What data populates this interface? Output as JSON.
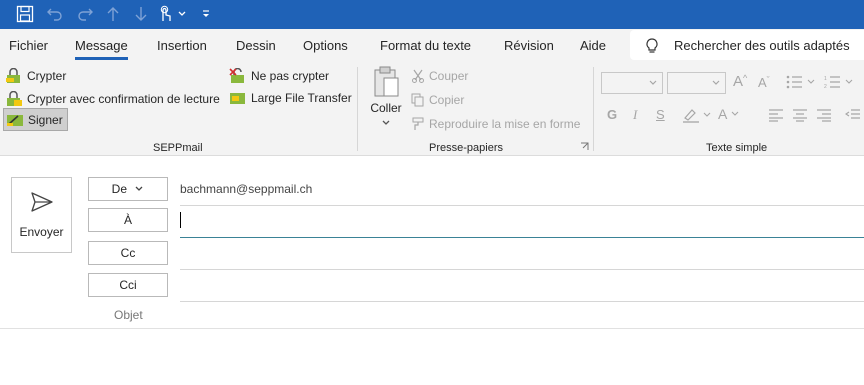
{
  "qat": {
    "icons": [
      "save-icon",
      "undo-icon",
      "redo-icon",
      "up-arrow-icon",
      "down-arrow-icon",
      "touch-mode-icon",
      "dropdown-icon",
      "customize-icon"
    ]
  },
  "tabs": [
    "Fichier",
    "Message",
    "Insertion",
    "Dessin",
    "Options",
    "Format du texte",
    "Révision",
    "Aide"
  ],
  "active_tab": "Message",
  "search": {
    "label": "Rechercher des outils adaptés"
  },
  "seppmail": {
    "crypter": "Crypter",
    "crypter_conf": "Crypter avec confirmation de lecture",
    "signer": "Signer",
    "ne_pas_crypter": "Ne pas crypter",
    "large_file": "Large File Transfer",
    "group_label": "SEPPmail"
  },
  "clipboard": {
    "coller": "Coller",
    "couper": "Couper",
    "copier": "Copier",
    "reproduire": "Reproduire la mise en forme",
    "group_label": "Presse-papiers"
  },
  "texte_simple": {
    "group_label": "Texte simple",
    "bold": "G",
    "italic": "I",
    "underline": "S",
    "grow": "A",
    "shrink": "A",
    "font_color": "A"
  },
  "compose": {
    "send_label": "Envoyer",
    "from_label": "De",
    "to_label": "À",
    "cc_label": "Cc",
    "bcc_label": "Cci",
    "subject_label": "Objet",
    "from_address": "bachmann@seppmail.ch",
    "to_value": "",
    "cc_value": "",
    "bcc_value": "",
    "subject_value": ""
  },
  "colors": {
    "titlebar": "#1f62b7",
    "ribbon_bg": "#f3f3f3",
    "accent": "#1f62b7",
    "focus_line": "#3a8296",
    "sepp_green": "#8ab83c",
    "sepp_yellow": "#f2c811"
  }
}
